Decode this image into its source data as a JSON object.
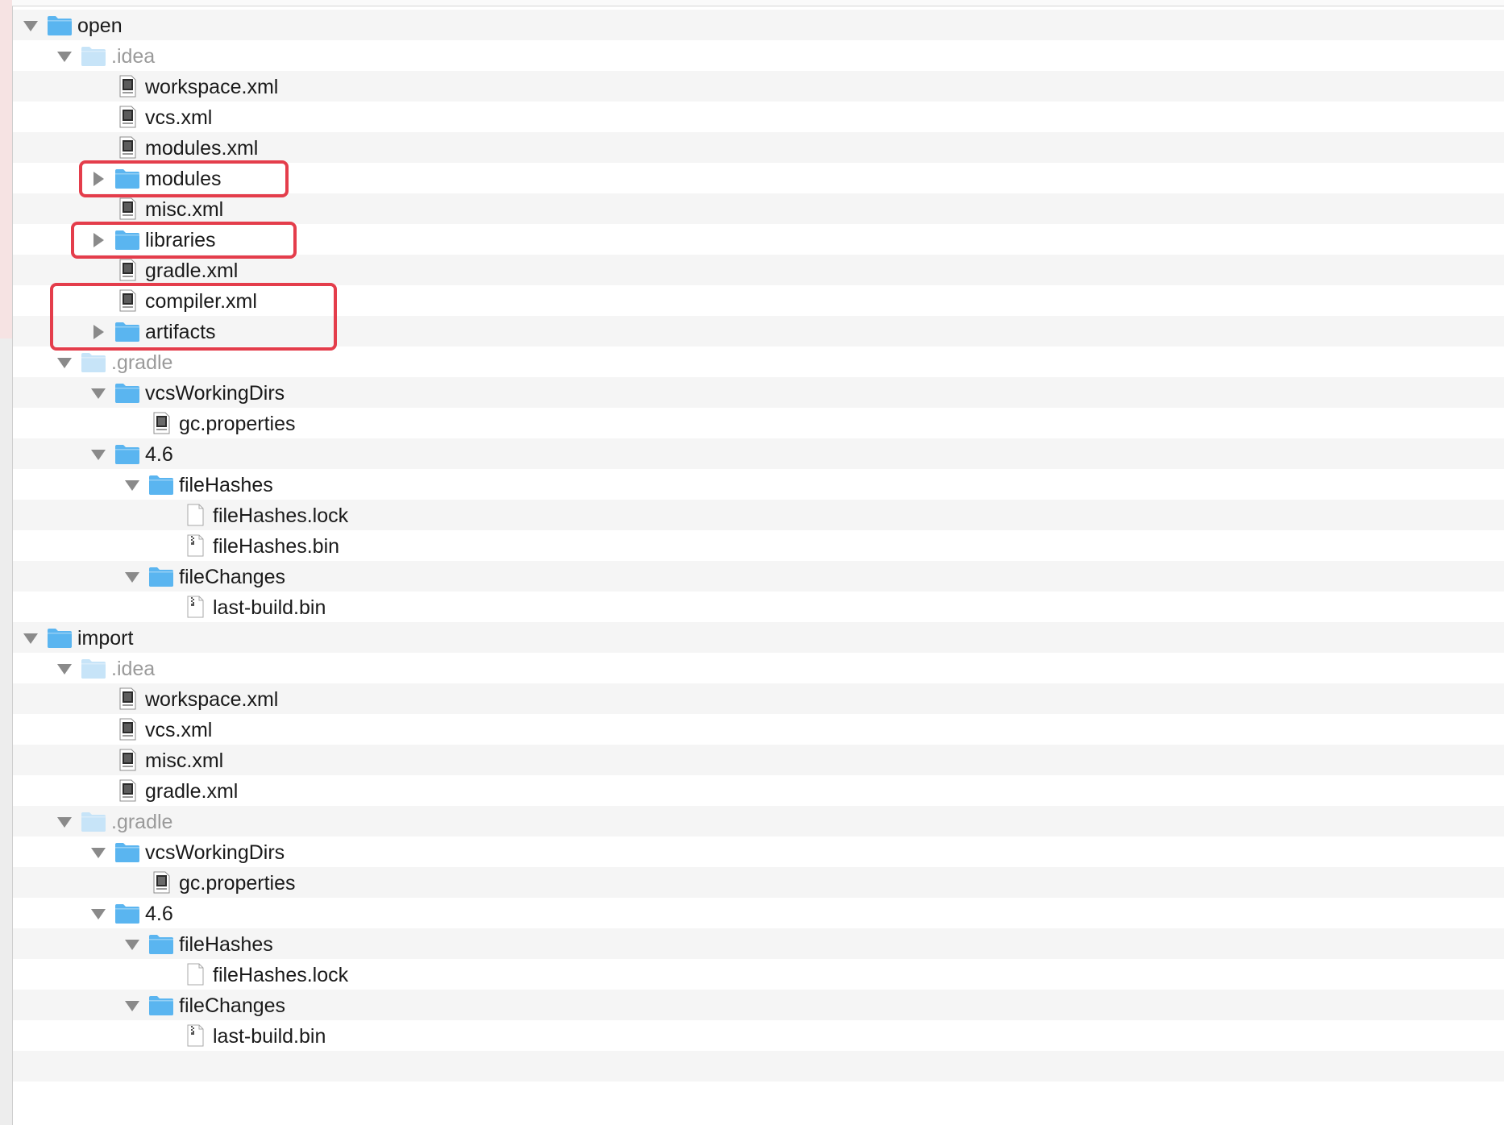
{
  "tree": [
    {
      "label": "open",
      "kind": "folder",
      "state": "open",
      "depth": 0,
      "hidden": false
    },
    {
      "label": ".idea",
      "kind": "folder",
      "state": "open",
      "depth": 1,
      "hidden": true
    },
    {
      "label": "workspace.xml",
      "kind": "xml-file",
      "state": "none",
      "depth": 2,
      "hidden": false
    },
    {
      "label": "vcs.xml",
      "kind": "xml-file",
      "state": "none",
      "depth": 2,
      "hidden": false
    },
    {
      "label": "modules.xml",
      "kind": "xml-file",
      "state": "none",
      "depth": 2,
      "hidden": false
    },
    {
      "label": "modules",
      "kind": "folder",
      "state": "closed",
      "depth": 2,
      "hidden": false
    },
    {
      "label": "misc.xml",
      "kind": "xml-file",
      "state": "none",
      "depth": 2,
      "hidden": false
    },
    {
      "label": "libraries",
      "kind": "folder",
      "state": "closed",
      "depth": 2,
      "hidden": false
    },
    {
      "label": "gradle.xml",
      "kind": "xml-file",
      "state": "none",
      "depth": 2,
      "hidden": false
    },
    {
      "label": "compiler.xml",
      "kind": "xml-file",
      "state": "none",
      "depth": 2,
      "hidden": false
    },
    {
      "label": "artifacts",
      "kind": "folder",
      "state": "closed",
      "depth": 2,
      "hidden": false
    },
    {
      "label": ".gradle",
      "kind": "folder",
      "state": "open",
      "depth": 1,
      "hidden": true
    },
    {
      "label": "vcsWorkingDirs",
      "kind": "folder",
      "state": "open",
      "depth": 2,
      "hidden": false
    },
    {
      "label": "gc.properties",
      "kind": "java-file",
      "state": "none",
      "depth": 3,
      "hidden": false
    },
    {
      "label": "4.6",
      "kind": "folder",
      "state": "open",
      "depth": 2,
      "hidden": false
    },
    {
      "label": "fileHashes",
      "kind": "folder",
      "state": "open",
      "depth": 3,
      "hidden": false
    },
    {
      "label": "fileHashes.lock",
      "kind": "blank-file",
      "state": "none",
      "depth": 4,
      "hidden": false
    },
    {
      "label": "fileHashes.bin",
      "kind": "binary-file",
      "state": "none",
      "depth": 4,
      "hidden": false
    },
    {
      "label": "fileChanges",
      "kind": "folder",
      "state": "open",
      "depth": 3,
      "hidden": false
    },
    {
      "label": "last-build.bin",
      "kind": "binary-file",
      "state": "none",
      "depth": 4,
      "hidden": false
    },
    {
      "label": "import",
      "kind": "folder",
      "state": "open",
      "depth": 0,
      "hidden": false
    },
    {
      "label": ".idea",
      "kind": "folder",
      "state": "open",
      "depth": 1,
      "hidden": true
    },
    {
      "label": "workspace.xml",
      "kind": "xml-file",
      "state": "none",
      "depth": 2,
      "hidden": false
    },
    {
      "label": "vcs.xml",
      "kind": "xml-file",
      "state": "none",
      "depth": 2,
      "hidden": false
    },
    {
      "label": "misc.xml",
      "kind": "xml-file",
      "state": "none",
      "depth": 2,
      "hidden": false
    },
    {
      "label": "gradle.xml",
      "kind": "xml-file",
      "state": "none",
      "depth": 2,
      "hidden": false
    },
    {
      "label": ".gradle",
      "kind": "folder",
      "state": "open",
      "depth": 1,
      "hidden": true
    },
    {
      "label": "vcsWorkingDirs",
      "kind": "folder",
      "state": "open",
      "depth": 2,
      "hidden": false
    },
    {
      "label": "gc.properties",
      "kind": "java-file",
      "state": "none",
      "depth": 3,
      "hidden": false
    },
    {
      "label": "4.6",
      "kind": "folder",
      "state": "open",
      "depth": 2,
      "hidden": false
    },
    {
      "label": "fileHashes",
      "kind": "folder",
      "state": "open",
      "depth": 3,
      "hidden": false
    },
    {
      "label": "fileHashes.lock",
      "kind": "blank-file",
      "state": "none",
      "depth": 4,
      "hidden": false
    },
    {
      "label": "fileChanges",
      "kind": "folder",
      "state": "open",
      "depth": 3,
      "hidden": false
    },
    {
      "label": "last-build.bin",
      "kind": "binary-file",
      "state": "none",
      "depth": 4,
      "hidden": false
    }
  ],
  "annotations": [
    {
      "color": "#e43d4b",
      "covers": [
        "modules"
      ]
    },
    {
      "color": "#e43d4b",
      "covers": [
        "libraries"
      ]
    },
    {
      "color": "#e43d4b",
      "covers": [
        "compiler.xml",
        "artifacts"
      ]
    }
  ],
  "colors": {
    "folder": "#5bb5f0",
    "folder_hidden": "#c7e4f8",
    "disclosure": "#8a8a8a",
    "highlight": "#e43d4b"
  }
}
